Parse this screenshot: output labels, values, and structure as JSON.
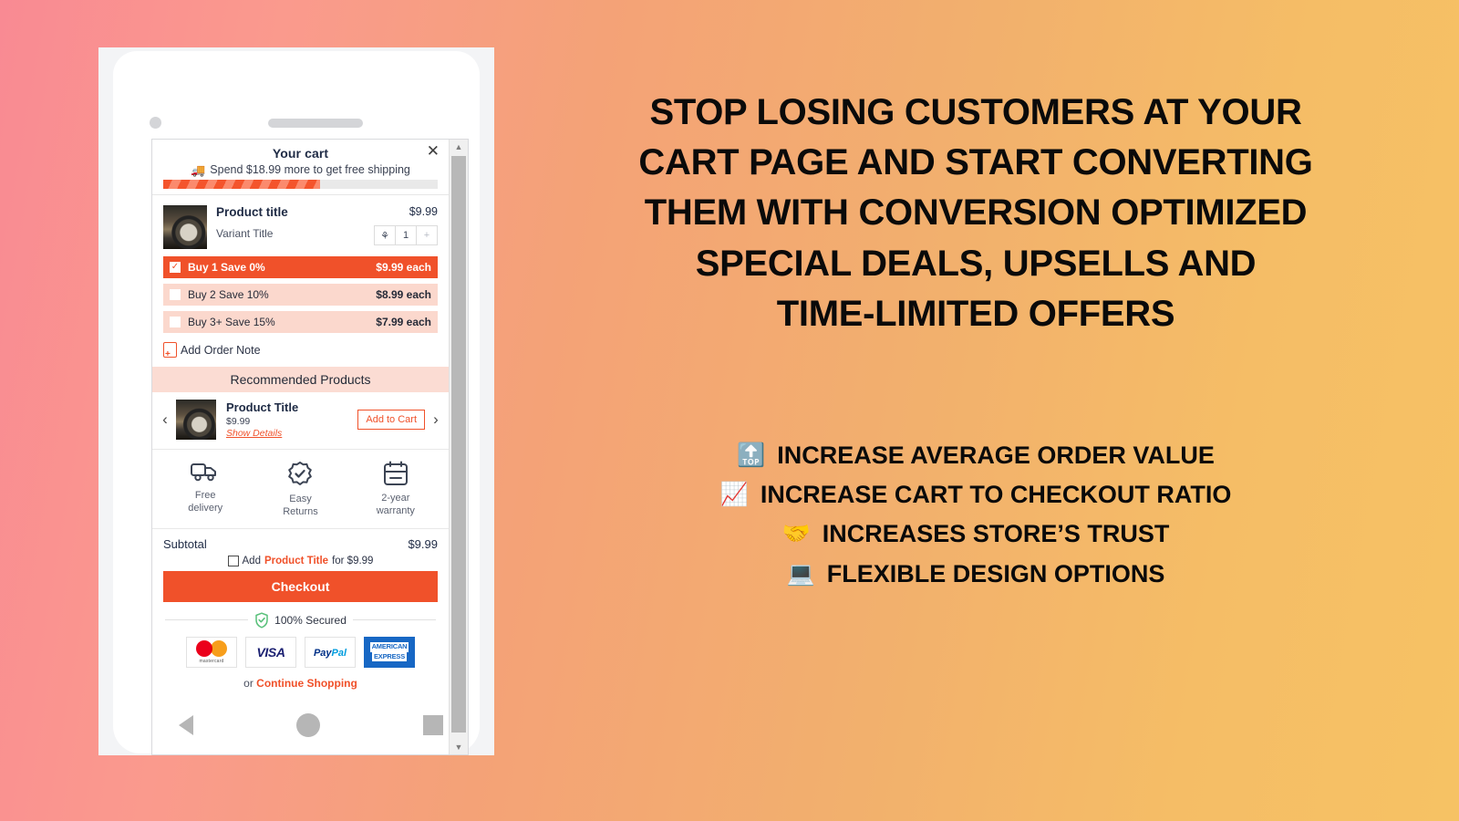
{
  "cart": {
    "title": "Your cart",
    "close_icon": "close-icon",
    "free_shipping_text": "Spend $18.99 more to get free shipping",
    "truck_icon": "delivery-truck-icon",
    "progress_percent": 57,
    "product": {
      "title": "Product title",
      "variant": "Variant Title",
      "price": "$9.99",
      "qty_remove_icon": "trash-icon",
      "qty_value": "1",
      "qty_plus": "+"
    },
    "tiers": [
      {
        "label": "Buy 1 Save 0%",
        "price": "$9.99 each",
        "selected": true,
        "check": "✓"
      },
      {
        "label": "Buy 2 Save 10%",
        "price": "$8.99 each",
        "selected": false,
        "check": ""
      },
      {
        "label": "Buy 3+ Save 15%",
        "price": "$7.99 each",
        "selected": false,
        "check": ""
      }
    ],
    "order_note": "Add Order Note",
    "recommended": {
      "heading": "Recommended Products",
      "prev_arrow": "‹",
      "next_arrow": "›",
      "title": "Product Title",
      "price": "$9.99",
      "show_details": "Show Details",
      "add_to_cart": "Add to Cart"
    },
    "trust": [
      {
        "icon": "truck-icon",
        "line1": "Free",
        "line2": "delivery"
      },
      {
        "icon": "badge-check-icon",
        "line1": "Easy",
        "line2": "Returns"
      },
      {
        "icon": "calendar-icon",
        "line1": "2-year",
        "line2": "warranty"
      }
    ],
    "subtotal_label": "Subtotal",
    "subtotal_value": "$9.99",
    "addon": {
      "add": "Add",
      "product": "Product Title",
      "for": "for $9.99"
    },
    "checkout": "Checkout",
    "secured": "100% Secured",
    "shield_icon": "shield-check-icon",
    "payments": [
      {
        "name": "mastercard",
        "caption": "mastercard"
      },
      {
        "name": "visa",
        "label": "VISA"
      },
      {
        "name": "paypal",
        "label1": "Pay",
        "label2": "Pal"
      },
      {
        "name": "amex",
        "label1": "AMERICAN",
        "label2": "EXPRESS"
      }
    ],
    "continue_or": "or",
    "continue_link": "Continue Shopping"
  },
  "phone": {
    "camera_icon": "camera-dot-icon",
    "speaker_icon": "speaker-grill-icon",
    "nav_back_icon": "back-triangle-icon",
    "nav_home_icon": "home-circle-icon",
    "nav_recents_icon": "recents-square-icon",
    "scrollbar_up": "▲",
    "scrollbar_down": "▼"
  },
  "promo": {
    "headline_lines": [
      "STOP LOSING CUSTOMERS AT YOUR",
      "CART PAGE AND START CONVERTING",
      "THEM WITH CONVERSION OPTIMIZED",
      "SPECIAL DEALS, UPSELLS AND",
      "TIME-LIMITED OFFERS"
    ],
    "bullets": [
      {
        "icon": "🔝",
        "icon_name": "top-arrow-icon",
        "text": "INCREASE AVERAGE ORDER VALUE"
      },
      {
        "icon": "📈",
        "icon_name": "chart-increasing-icon",
        "text": "INCREASE CART TO CHECKOUT RATIO"
      },
      {
        "icon": "🤝",
        "icon_name": "handshake-icon",
        "text": "INCREASES STORE’S TRUST"
      },
      {
        "icon": "💻",
        "icon_name": "laptop-icon",
        "text": "FLEXIBLE DESIGN OPTIONS"
      }
    ]
  },
  "colors": {
    "accent": "#f0512a",
    "tier_alt": "#fbd8cd",
    "rec_head": "#fbdcd3",
    "bg_left": "#f98a93",
    "bg_right": "#f6c264"
  }
}
